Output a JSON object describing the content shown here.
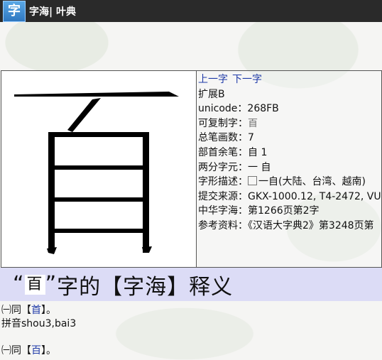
{
  "app": {
    "logo_text": "字",
    "title": "字海| 叶典"
  },
  "char": {
    "glyph": "𦣻",
    "stroke_color": "#000000"
  },
  "nav": {
    "prev": "上一字",
    "next": "下一字"
  },
  "info": [
    {
      "key": "",
      "value": "扩展B"
    },
    {
      "key": "unicode：",
      "value": "268FB"
    },
    {
      "key": "可复制字：",
      "value": "𦣻"
    },
    {
      "key": "总笔画数：",
      "value": "7"
    },
    {
      "key": "部首余笔：",
      "value": "自 1"
    },
    {
      "key": "两分字元：",
      "value": "一 自"
    },
    {
      "key": "字形描述：",
      "value": "一自(大陆、台湾、越南)"
    },
    {
      "key": "提交来源：",
      "value": "GKX-1000.12, T4-2472, VU"
    },
    {
      "key": "中华字海：",
      "value": "第1266页第2字"
    },
    {
      "key": "参考资料：",
      "value": "《汉语大字典2》第3248页第"
    }
  ],
  "heading": {
    "open_quote": "“",
    "glyph": "𦣻",
    "close_quote": "”",
    "text": "字的【字海】释义"
  },
  "defs": [
    {
      "num": "㈠同【",
      "link": "首",
      "tail": "】。"
    },
    {
      "text": "拼音shou3,bai3"
    },
    {
      "num": "㈠同【",
      "link": "百",
      "tail": "】。"
    }
  ],
  "colors": {
    "accent": "#1f3aa8",
    "heading_bg": "#dcdcf6",
    "titlebar": "#2a2a2a"
  }
}
